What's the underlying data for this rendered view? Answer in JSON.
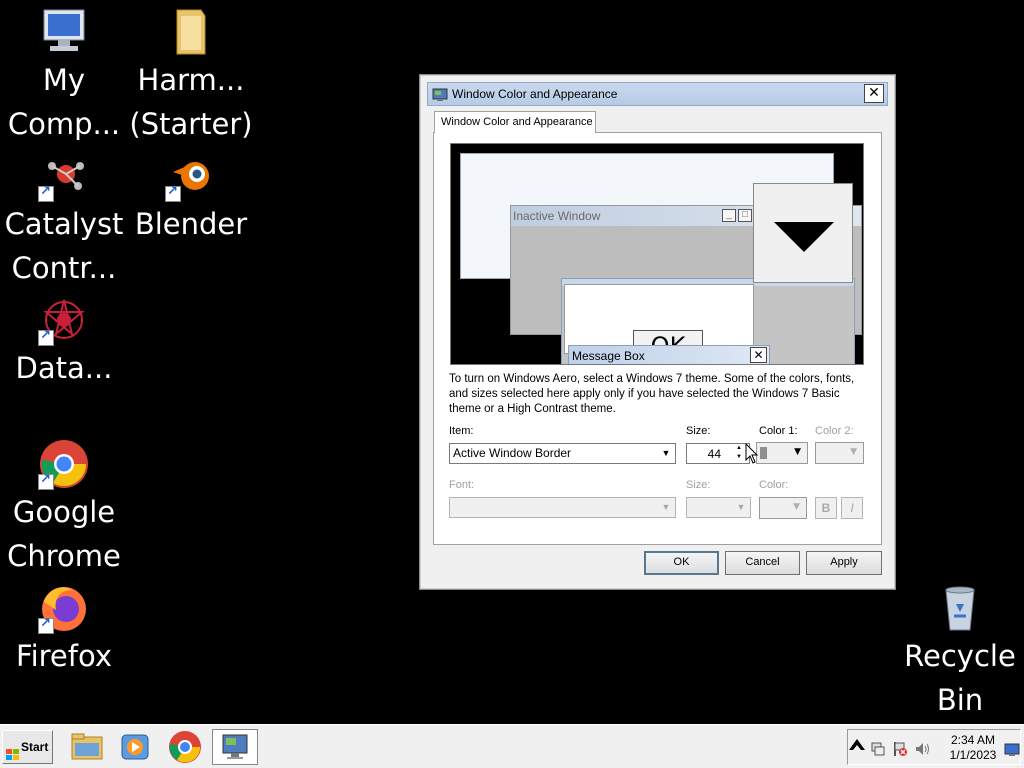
{
  "desktop": {
    "icons": [
      {
        "label": "My\nComp...",
        "icon": "computer-icon"
      },
      {
        "label": "Harm...\n(Starter)",
        "icon": "folder-icon"
      },
      {
        "label": "Catalyst\nContr...",
        "icon": "catalyst-icon"
      },
      {
        "label": "Blender",
        "icon": "blender-icon"
      },
      {
        "label": "Data...",
        "icon": "data-icon"
      },
      {
        "label": "Google\nChrome",
        "icon": "chrome-icon"
      },
      {
        "label": "Firefox",
        "icon": "firefox-icon"
      },
      {
        "label": "Recycle\nBin",
        "icon": "recycle-bin-icon"
      }
    ]
  },
  "dialog": {
    "title": "Window Color and Appearance",
    "tab": "Window Color and Appearance",
    "preview": {
      "inactive_title": "Inactive Window",
      "ok_text": "OK",
      "message_box_title": "Message Box"
    },
    "description": "To turn on Windows Aero, select a Windows 7 theme.  Some of the colors, fonts, and sizes selected here apply only if you have selected the Windows 7 Basic theme or a High Contrast theme.",
    "item_label": "Item:",
    "item_value": "Active Window Border",
    "size_label": "Size:",
    "size_value": "44",
    "color1_label": "Color 1:",
    "color2_label": "Color 2:",
    "font_label": "Font:",
    "font_size_label": "Size:",
    "font_color_label": "Color:",
    "bold_label": "B",
    "italic_label": "I",
    "buttons": {
      "ok": "OK",
      "cancel": "Cancel",
      "apply": "Apply"
    }
  },
  "taskbar": {
    "start_label": "Start",
    "pinned": [
      "file-explorer-icon",
      "media-player-icon",
      "chrome-icon",
      "display-settings-icon"
    ],
    "clock_time": "2:34 AM",
    "clock_date": "1/1/2023"
  },
  "colors": {
    "desktop_bg": "#000000",
    "title_bar": "#b7cbe6",
    "dialog_bg": "#f0f0f0"
  }
}
